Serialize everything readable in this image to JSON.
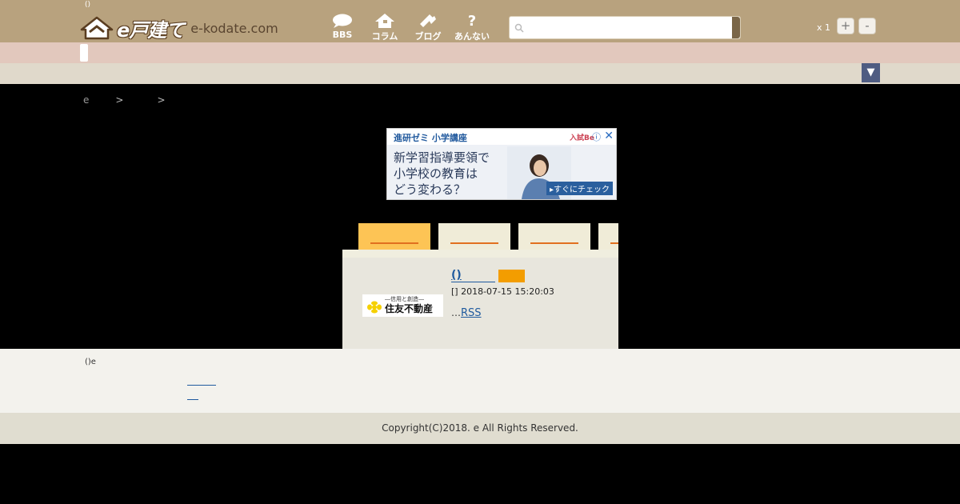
{
  "header": {
    "tagline": "()",
    "logo_word": "e戸建て",
    "logo_domain": "e-kodate.com",
    "nav": [
      {
        "label": "BBS",
        "icon": "chat-bubble-icon"
      },
      {
        "label": "コラム",
        "icon": "house-icon"
      },
      {
        "label": "ブログ",
        "icon": "pencil-icon"
      },
      {
        "label": "あんない",
        "icon": "question-icon"
      }
    ],
    "search": {
      "value": "",
      "placeholder": ""
    },
    "zoom": {
      "label": "x 1",
      "plus": "+",
      "minus": "-"
    }
  },
  "menu_toggle": "▼",
  "breadcrumb": {
    "home": "e",
    "sep1": ">",
    "sep2": ">"
  },
  "ad": {
    "title": "進研ゼミ 小学講座",
    "text_line1": "新学習指導要領で",
    "text_line2": "小学校の教育は",
    "text_line3": "どう変わる？",
    "cta": "▸すぐにチェック",
    "close": "✕",
    "info": "ⓘ",
    "brand": "入試Be"
  },
  "entry": {
    "logo_top": "―信用と創造―",
    "logo_name": "住友不動産",
    "title": "()",
    "date": "[] 2018-07-15 15:20:03",
    "ellipsis": "…",
    "rss": "RSS"
  },
  "footer": {
    "note": "()e",
    "copyright": "Copyright(C)2018. e All Rights Reserved."
  },
  "colors": {
    "header": "#b8a27e",
    "accent_orange": "#f39d00",
    "tab_active": "#fdc455",
    "link": "#1f5a9e",
    "toggle": "#4f5c82"
  }
}
